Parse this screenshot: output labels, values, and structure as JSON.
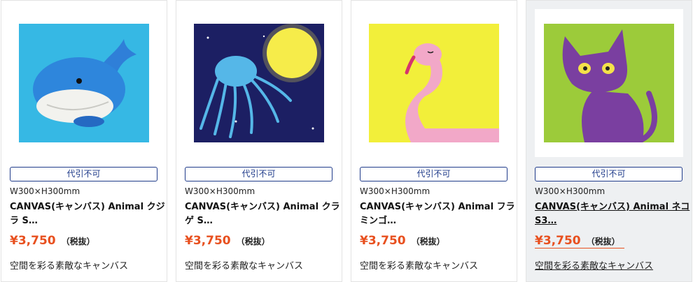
{
  "products": [
    {
      "badge": "代引不可",
      "size": "W300×H300mm",
      "name_line1": "CANVAS(キャンバス) Animal クジ",
      "name_line2": "ラ S…",
      "price": "¥3,750",
      "tax": "（税抜）",
      "description": "空間を彩る素敵なキャンバス",
      "image_icon": "whale-painting",
      "bg_color": "#36b8e4"
    },
    {
      "badge": "代引不可",
      "size": "W300×H300mm",
      "name_line1": "CANVAS(キャンバス) Animal クラ",
      "name_line2": "ゲ S…",
      "price": "¥3,750",
      "tax": "（税抜）",
      "description": "空間を彩る素敵なキャンバス",
      "image_icon": "jellyfish-moon-painting",
      "bg_color": "#1c1f63"
    },
    {
      "badge": "代引不可",
      "size": "W300×H300mm",
      "name_line1": "CANVAS(キャンバス) Animal フラ",
      "name_line2": "ミンゴ…",
      "price": "¥3,750",
      "tax": "（税抜）",
      "description": "空間を彩る素敵なキャンバス",
      "image_icon": "flamingo-painting",
      "bg_color": "#f2ef3a"
    },
    {
      "badge": "代引不可",
      "size": "W300×H300mm",
      "name_line1": "CANVAS(キャンバス) Animal ネコ",
      "name_line2": "S3…",
      "price": "¥3,750",
      "tax": "（税抜）",
      "description": "空間を彩る素敵なキャンバス",
      "image_icon": "cat-painting",
      "bg_color": "#9ccb3a"
    }
  ]
}
